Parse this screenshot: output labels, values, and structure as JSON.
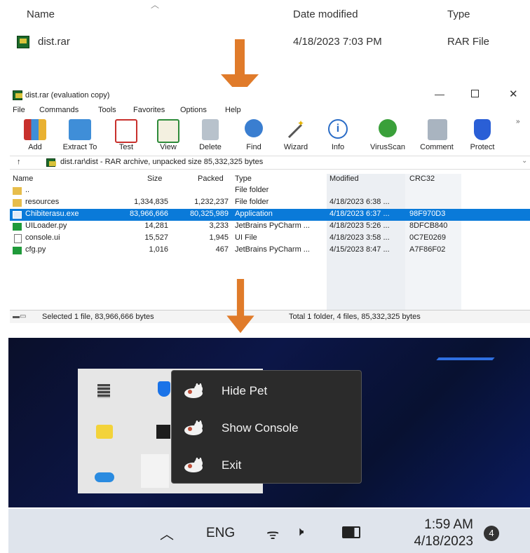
{
  "explorer": {
    "headers": {
      "name": "Name",
      "date": "Date modified",
      "type": "Type"
    },
    "file": {
      "name": "dist.rar",
      "date": "4/18/2023 7:03 PM",
      "type": "RAR File"
    }
  },
  "winrar": {
    "title": "dist.rar (evaluation copy)",
    "menu": [
      "File",
      "Commands",
      "Tools",
      "Favorites",
      "Options",
      "Help"
    ],
    "toolbar": [
      "Add",
      "Extract To",
      "Test",
      "View",
      "Delete",
      "Find",
      "Wizard",
      "Info",
      "VirusScan",
      "Comment",
      "Protect"
    ],
    "address": "dist.rar\\dist - RAR archive, unpacked size 85,332,325 bytes",
    "columns": [
      "Name",
      "Size",
      "Packed",
      "Type",
      "Modified",
      "CRC32"
    ],
    "rows": [
      {
        "name": "..",
        "size": "",
        "packed": "",
        "type": "File folder",
        "modified": "",
        "crc": ""
      },
      {
        "name": "resources",
        "size": "1,334,835",
        "packed": "1,232,237",
        "type": "File folder",
        "modified": "4/18/2023 6:38 ...",
        "crc": ""
      },
      {
        "name": "Chibiterasu.exe",
        "size": "83,966,666",
        "packed": "80,325,989",
        "type": "Application",
        "modified": "4/18/2023 6:37 ...",
        "crc": "98F970D3"
      },
      {
        "name": "UILoader.py",
        "size": "14,281",
        "packed": "3,233",
        "type": "JetBrains PyCharm ...",
        "modified": "4/18/2023 5:26 ...",
        "crc": "8DFCB840"
      },
      {
        "name": "console.ui",
        "size": "15,527",
        "packed": "1,945",
        "type": "UI File",
        "modified": "4/18/2023 3:58 ...",
        "crc": "0C7E0269"
      },
      {
        "name": "cfg.py",
        "size": "1,016",
        "packed": "467",
        "type": "JetBrains PyCharm ...",
        "modified": "4/15/2023 8:47 ...",
        "crc": "A7F86F02"
      }
    ],
    "status_left": "Selected 1 file, 83,966,666 bytes",
    "status_right": "Total 1 folder, 4 files, 85,332,325 bytes",
    "colors": {
      "selection": "#0a7ad9"
    }
  },
  "context_menu": {
    "items": [
      "Hide Pet",
      "Show Console",
      "Exit"
    ]
  },
  "taskbar": {
    "lang": "ENG",
    "time": "1:59 AM",
    "date": "4/18/2023",
    "badge": "4"
  },
  "colors": {
    "arrow": "#e07b2a",
    "menu_bg": "#2b2b2b"
  }
}
